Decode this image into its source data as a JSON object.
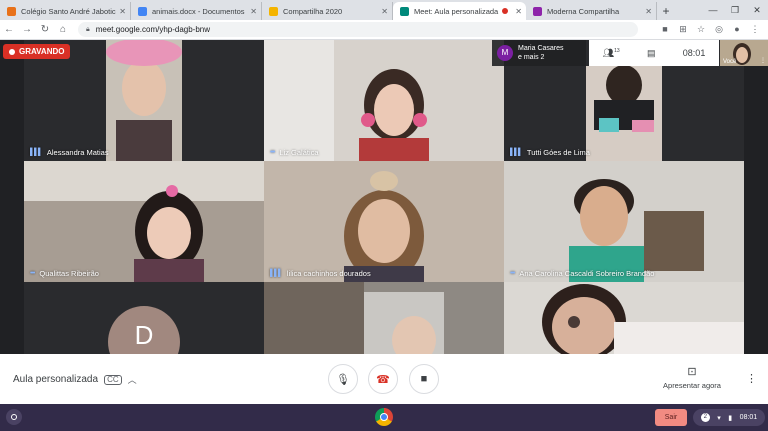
{
  "browser": {
    "tabs": [
      {
        "title": "Colégio Santo André Jaboticab",
        "favicon_color": "#e8711a",
        "active": false
      },
      {
        "title": "animais.docx - Documentos Go",
        "favicon_color": "#4285f4",
        "active": false
      },
      {
        "title": "Compartilha 2020",
        "favicon_color": "#f4b400",
        "active": false
      },
      {
        "title": "Meet: Aula personalizada",
        "favicon_color": "#00897b",
        "active": true,
        "recording": true
      },
      {
        "title": "Moderna Compartilha",
        "favicon_color": "#8e24aa",
        "active": false
      }
    ],
    "new_tab": "+",
    "url": "meet.google.com/yhp-dagb-bnw"
  },
  "meet": {
    "recording_label": "GRAVANDO",
    "others_chip": {
      "avatar_letter": "M",
      "line1": "Maria Casares",
      "line2": "e mais 2"
    },
    "participants_count": "13",
    "time": "08:01",
    "self_label": "Você",
    "tiles": [
      {
        "name": "Alessandra Matias",
        "bg": "#2a2b2e",
        "face": "#d9b7a0"
      },
      {
        "name": "Liz Galática",
        "bg": "#d7d2cc",
        "face": "#e8c7b4"
      },
      {
        "name": "Tutti Góes de Lima",
        "bg": "#2a2b2e",
        "face": "#e4d3c7"
      },
      {
        "name": "Qualittas Ribeirão",
        "bg": "#9a8f84",
        "face": "#e6c5b2"
      },
      {
        "name": "lilica cachinhos dourados",
        "bg": "#bfb2a6",
        "face": "#d8b69c"
      },
      {
        "name": "Ana Carolina Cascaldi Sobreiro Brandão",
        "bg": "#c9c6c0",
        "face": "#d2a888"
      },
      {
        "name": "",
        "avatar_letter": "D",
        "bg": "#3c4043",
        "face": ""
      },
      {
        "name": "",
        "bg": "#8c8780",
        "face": "#e3c6b2"
      },
      {
        "name": "",
        "bg": "#d9d6d1",
        "face": "#d7b09a"
      }
    ],
    "meeting_name": "Aula personalizada",
    "present_label": "Apresentar agora",
    "colors": {
      "end_call": "#d93025",
      "recording": "#d93025",
      "mic_indicator": "#8ab4f8"
    }
  },
  "shelf": {
    "signout_label": "Sair",
    "notification_count": "2",
    "clock": "08:01"
  }
}
